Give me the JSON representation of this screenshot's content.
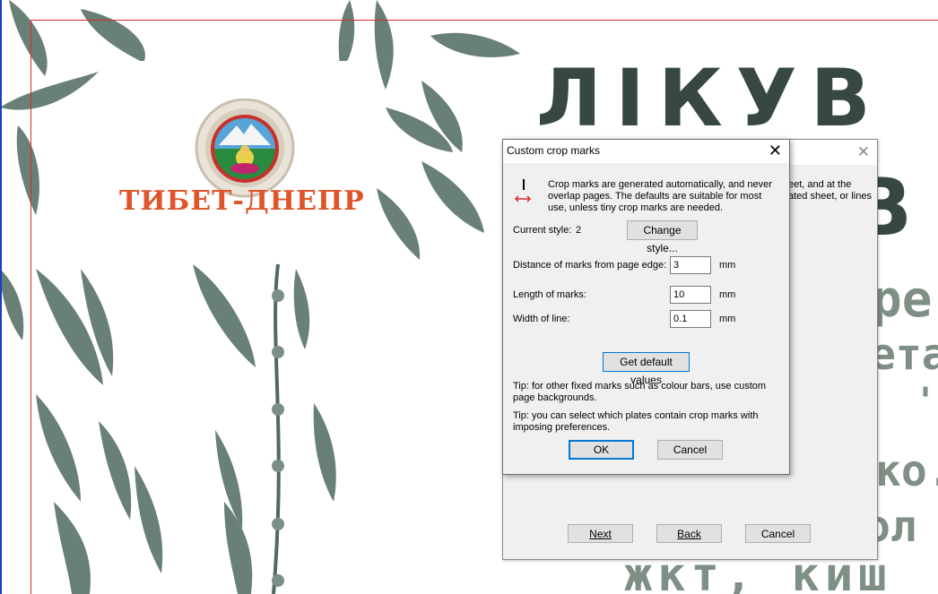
{
  "document": {
    "logo_text": "ТИБЕТ-ДНЕПР",
    "headline_line1": "ЛІКУВ",
    "headline_line2": "В",
    "body_fragments": [
      "ре",
      "ета",
      "'",
      ", ",
      "ко.",
      "ол",
      "жкт, киш"
    ]
  },
  "wizard": {
    "partial_text": [
      "eet, and at the",
      "ated sheet, or lines"
    ],
    "next_label": "Next",
    "back_label": "Back",
    "cancel_label": "Cancel"
  },
  "dialog": {
    "title": "Custom crop marks",
    "info_text": "Crop marks are generated automatically, and never overlap pages. The defaults are suitable for most use, unless tiny crop marks are needed.",
    "current_style_label": "Current style:",
    "current_style_value": "2",
    "change_style_label": "Change style...",
    "distance_label": "Distance of marks from page edge:",
    "distance_value": "3",
    "length_label": "Length of marks:",
    "length_value": "10",
    "width_label": "Width of line:",
    "width_value": "0.1",
    "unit": "mm",
    "default_values_label": "Get default values",
    "tip1": "Tip: for other fixed marks such as colour bars, use custom page backgrounds.",
    "tip2": "Tip: you can select which plates contain crop marks with imposing preferences.",
    "ok_label": "OK",
    "cancel_label": "Cancel"
  },
  "colors": {
    "leaf": "#4f6a60",
    "headline": "#364840",
    "body_text": "#7e8f85",
    "logo": "#e0542a",
    "margin_guide": "#d62b2b",
    "focus": "#0078d7"
  },
  "icons": [
    "crop-marks-icon",
    "close-icon",
    "leaf-illustration",
    "tibet-dnepr-emblem-icon"
  ]
}
